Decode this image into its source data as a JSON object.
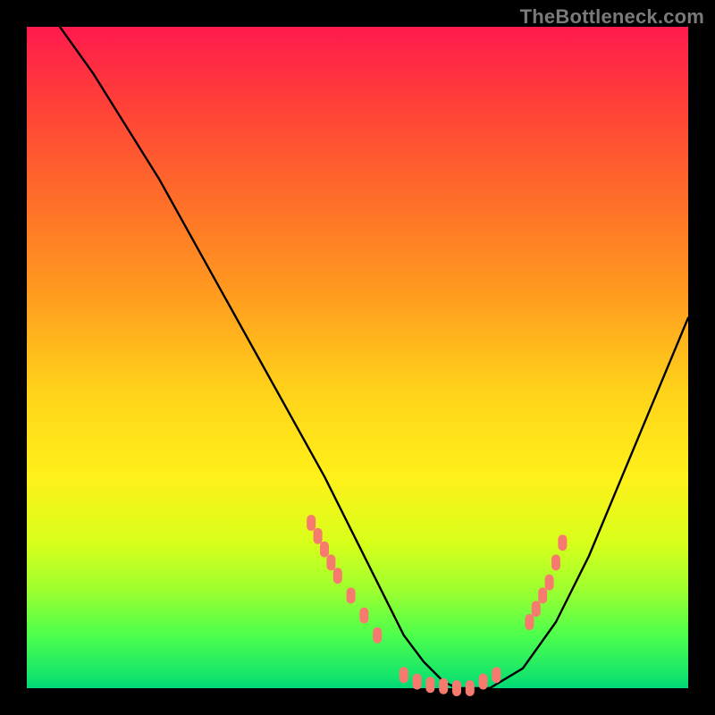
{
  "watermark": {
    "text": "TheBottleneck.com"
  },
  "chart_data": {
    "type": "line",
    "title": "",
    "xlabel": "",
    "ylabel": "",
    "xlim": [
      0,
      100
    ],
    "ylim": [
      0,
      100
    ],
    "series": [
      {
        "name": "bottleneck-curve",
        "x": [
          5,
          10,
          15,
          20,
          25,
          30,
          35,
          40,
          45,
          50,
          55,
          57,
          60,
          63,
          65,
          70,
          75,
          80,
          85,
          90,
          95,
          100
        ],
        "y": [
          100,
          93,
          85,
          77,
          68,
          59,
          50,
          41,
          32,
          22,
          12,
          8,
          4,
          1,
          0,
          0,
          3,
          10,
          20,
          32,
          44,
          56
        ]
      },
      {
        "name": "highlight-dots-left",
        "x": [
          43,
          44,
          45,
          46,
          47,
          49,
          51,
          53
        ],
        "y": [
          25,
          23,
          21,
          19,
          17,
          14,
          11,
          8
        ]
      },
      {
        "name": "highlight-dots-bottom",
        "x": [
          57,
          59,
          61,
          63,
          65,
          67,
          69,
          71
        ],
        "y": [
          2,
          1,
          0.5,
          0.3,
          0,
          0,
          1,
          2
        ]
      },
      {
        "name": "highlight-dots-right",
        "x": [
          76,
          77,
          78,
          79,
          80,
          81
        ],
        "y": [
          10,
          12,
          14,
          16,
          19,
          22
        ]
      }
    ],
    "colors": {
      "curve": "#000000",
      "dots": "#f77a6e",
      "gradient_top": "#ff1a4d",
      "gradient_bottom": "#00d877"
    }
  }
}
